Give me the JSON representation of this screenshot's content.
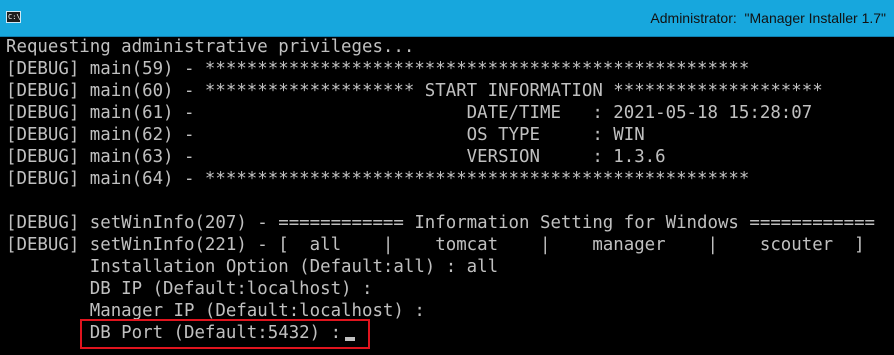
{
  "window": {
    "icon_label": "C:\\",
    "title": "Administrator:  \"Manager Installer 1.7\""
  },
  "console": {
    "lines": [
      "Requesting administrative privileges...",
      "[DEBUG] main(59) - ****************************************************",
      "[DEBUG] main(60) - ******************** START INFORMATION ********************",
      "[DEBUG] main(61) -                          DATE/TIME   : 2021-05-18 15:28:07",
      "[DEBUG] main(62) -                          OS TYPE     : WIN",
      "[DEBUG] main(63) -                          VERSION     : 1.3.6",
      "[DEBUG] main(64) - ****************************************************",
      "",
      "[DEBUG] setWinInfo(207) - ============ Information Setting for Windows ============",
      "[DEBUG] setWinInfo(221) - [  all    |    tomcat    |    manager    |    scouter  ]",
      "        Installation Option (Default:all) : all",
      "        DB IP (Default:localhost) :",
      "        Manager IP (Default:localhost) :",
      "        DB Port (Default:5432) :"
    ]
  },
  "highlight": {
    "color": "#e0141e"
  }
}
